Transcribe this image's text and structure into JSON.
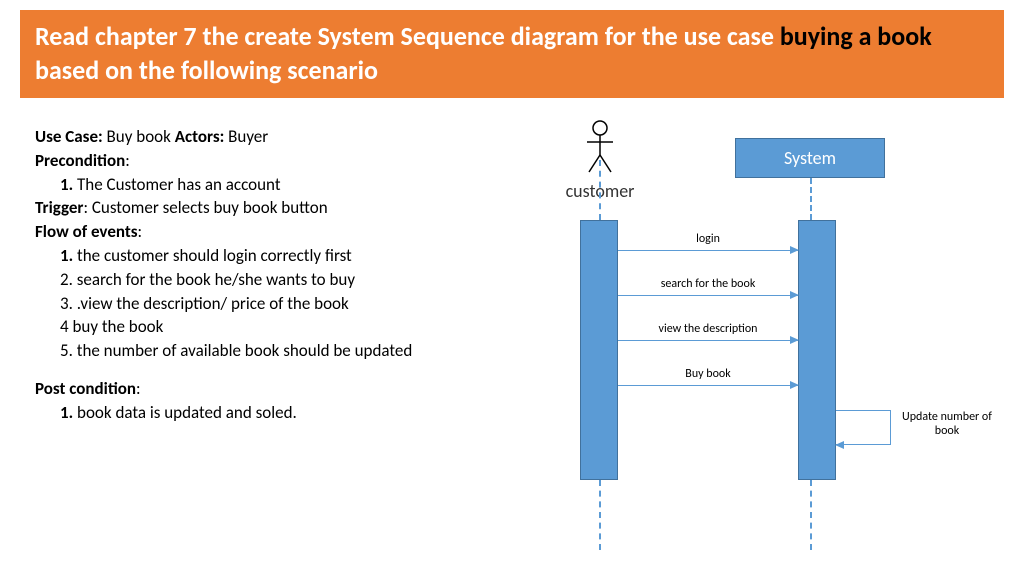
{
  "header": {
    "prefix": "Read chapter 7 the create System Sequence diagram for the use case ",
    "highlight": "buying a book",
    "suffix": " based on the following scenario"
  },
  "usecase": {
    "use_case_label": "Use Case:",
    "use_case_value": " Buy book ",
    "actors_label": "Actors:",
    "actors_value": " Buyer",
    "precondition_label": "Precondition",
    "precond_1_num": "1.",
    "precond_1_text": " The Customer has an account",
    "trigger_label": "Trigger",
    "trigger_value": ": Customer selects buy book button",
    "flow_label": "Flow of events",
    "flow_1_num": "1.",
    "flow_1_text": " the customer should login correctly first",
    "flow_2": "2. search for the book he/she wants to buy",
    "flow_3": "3. .view the description/ price of the book",
    "flow_4": "4  buy the book",
    "flow_5": "5. the number of available book should be updated",
    "post_label": "Post condition",
    "post_1_num": "1.",
    "post_1_text": " book data is updated and soled."
  },
  "diagram": {
    "actor": "customer",
    "system": "System",
    "messages": {
      "m1": "login",
      "m2": "search for the book",
      "m3": "view the description",
      "m4": "Buy book",
      "m5": "Update number of book"
    }
  }
}
